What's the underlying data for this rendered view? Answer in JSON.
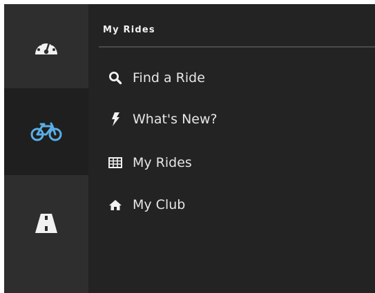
{
  "rail": {
    "items": [
      {
        "name": "dashboard",
        "icon": "speedometer-icon",
        "active": false
      },
      {
        "name": "rides",
        "icon": "bicycle-icon",
        "active": true
      },
      {
        "name": "routes",
        "icon": "road-icon",
        "active": false
      }
    ]
  },
  "panel": {
    "title": "My Rides",
    "items": [
      {
        "label": "Find a Ride",
        "icon": "search-icon"
      },
      {
        "label": "What's New?",
        "icon": "bolt-icon"
      },
      {
        "label": "My Rides",
        "icon": "table-icon"
      },
      {
        "label": "My Club",
        "icon": "home-icon"
      }
    ]
  },
  "colors": {
    "accent": "#5aaee6",
    "icon": "#f2f2f2",
    "text": "#e6e6e6",
    "rail_bg": "#2e2e2e",
    "rail_active_bg": "#1f1f1f",
    "panel_bg": "#232323"
  }
}
